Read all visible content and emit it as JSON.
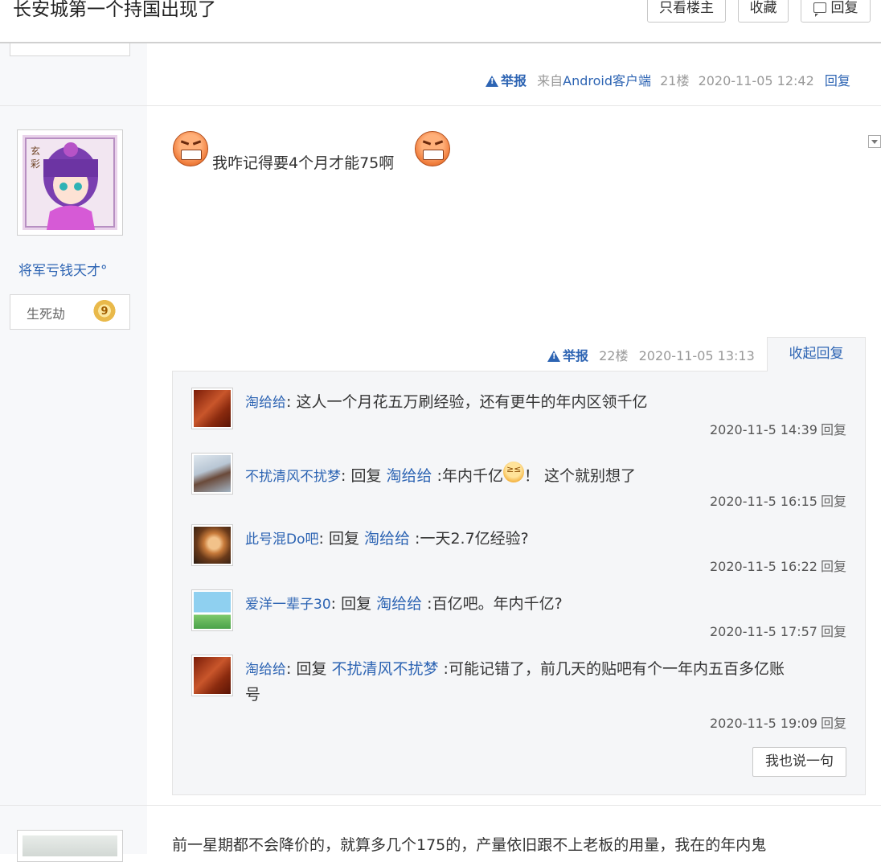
{
  "header": {
    "title": "长安城第一个持国出现了",
    "btn_only_op": "只看楼主",
    "btn_favorite": "收藏",
    "btn_reply": "回复"
  },
  "post21": {
    "report": "举报",
    "source": "来自Android客户端",
    "floor": "21楼",
    "time": "2020-11-05 12:42",
    "reply": "回复"
  },
  "post22": {
    "author": "将军亏钱天才°",
    "level_title": "生死劫",
    "level": "9",
    "content": "我咋记得要4个月才能75啊",
    "report": "举报",
    "floor": "22楼",
    "time": "2020-11-05 13:13",
    "collapse": "收起回复",
    "replies": [
      {
        "user": "淘给给",
        "text": ": 这人一个月花五万刷经验，还有更牛的年内区领千亿",
        "time": "2020-11-5 14:39",
        "btn": "回复"
      },
      {
        "user": "不扰清风不扰梦",
        "prefix": ": 回复 ",
        "ref": "淘给给",
        "text": " :年内千亿",
        "text2": "！ 这个就别想了",
        "time": "2020-11-5 16:15",
        "btn": "回复"
      },
      {
        "user": "此号混Do吧",
        "prefix": ": 回复 ",
        "ref": "淘给给",
        "text": " :一天2.7亿经验?",
        "time": "2020-11-5 16:22",
        "btn": "回复"
      },
      {
        "user": "爱洋一辈子30",
        "prefix": ": 回复 ",
        "ref": "淘给给",
        "text": " :百亿吧。年内千亿?",
        "time": "2020-11-5 17:57",
        "btn": "回复"
      },
      {
        "user": "淘给给",
        "prefix": ": 回复 ",
        "ref": "不扰清风不扰梦",
        "text": " :可能记错了，前几天的贴吧有个一年内五百多亿账",
        "text_cont": "号",
        "time": "2020-11-5 19:09",
        "btn": "回复"
      }
    ],
    "say_btn": "我也说一句"
  },
  "next_post": {
    "content": "前一星期都不会降价的，就算多几个175的，产量依旧跟不上老板的用量，我在的年内鬼"
  }
}
